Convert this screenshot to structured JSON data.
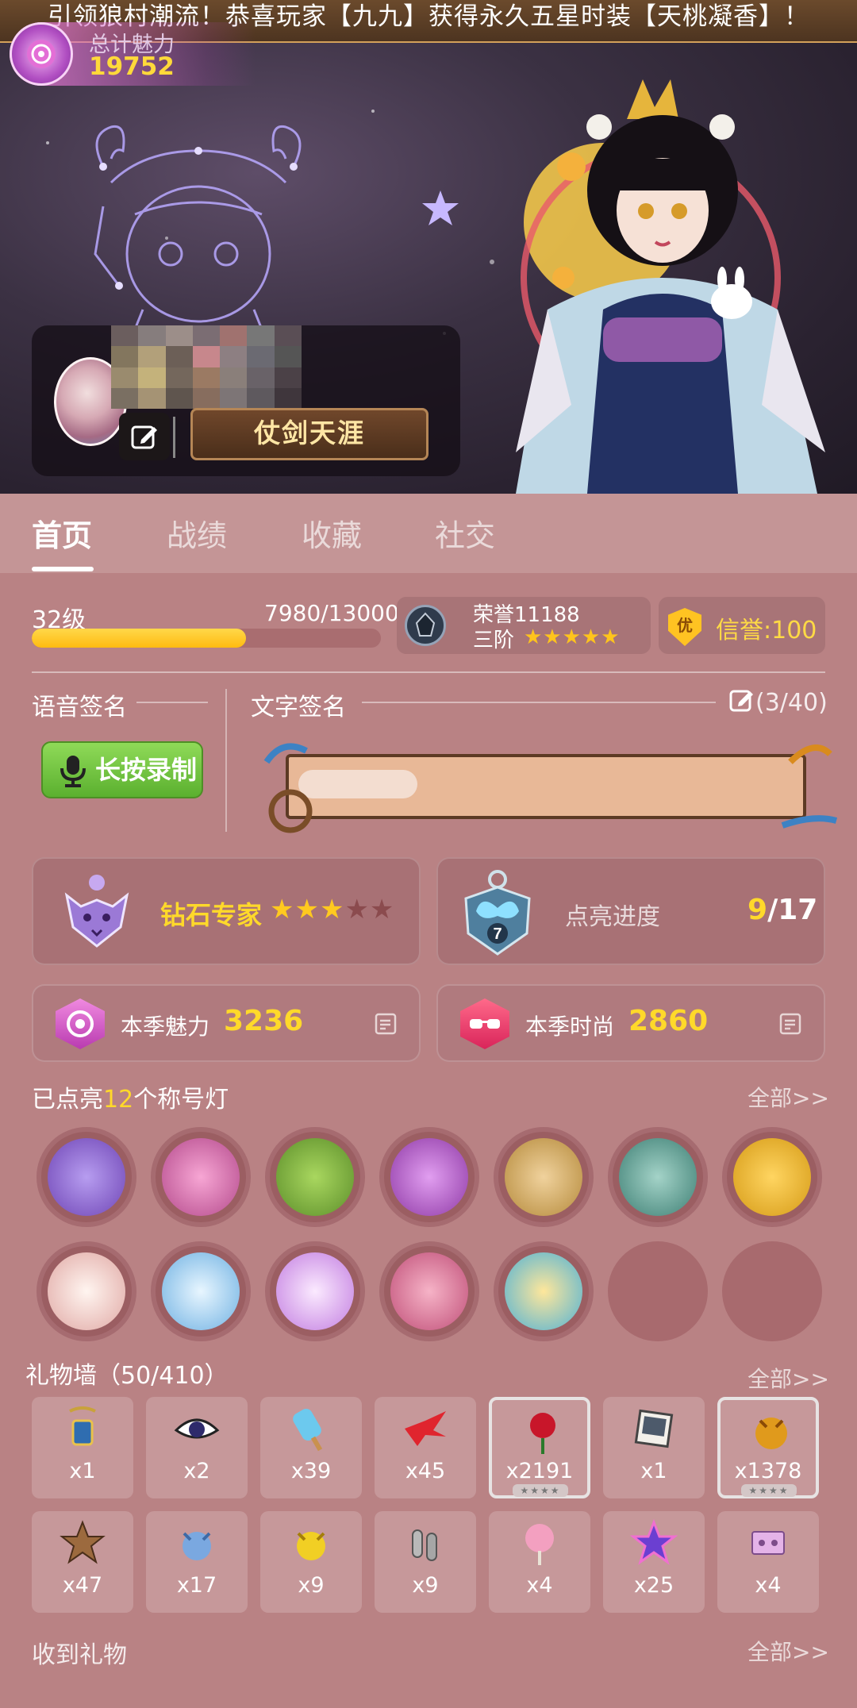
{
  "notice": "引领狼村潮流！恭喜玩家【九九】获得永久五星时装【天桃凝香】！",
  "charm_total": {
    "label": "总计魅力",
    "value": "19752"
  },
  "profile": {
    "title_badge": "仗剑天涯"
  },
  "tabs": [
    {
      "label": "首页",
      "active": true
    },
    {
      "label": "战绩",
      "active": false
    },
    {
      "label": "收藏",
      "active": false
    },
    {
      "label": "社交",
      "active": false
    }
  ],
  "level": {
    "label": "32级",
    "exp": "7980/13000",
    "progress": 0.614
  },
  "honor": {
    "label": "荣誉11188",
    "tier": "三阶",
    "stars": 5
  },
  "credit": {
    "icon_text": "优",
    "label": "信誉:100"
  },
  "signature": {
    "voice_label": "语音签名",
    "text_label": "文字签名",
    "count": "(3/40)",
    "record_button": "长按录制"
  },
  "rank": {
    "name": "钻石专家",
    "stars_on": 3,
    "stars_total": 5,
    "colors": {
      "on": "#ffc91f",
      "off": "#8b4b4e"
    }
  },
  "light": {
    "label": "点亮进度",
    "current": "9",
    "total": "/17",
    "emblem_number": "7"
  },
  "season": [
    {
      "label": "本季魅力",
      "value": "3236",
      "icon": "rose-icon"
    },
    {
      "label": "本季时尚",
      "value": "2860",
      "icon": "sunglasses-icon"
    }
  ],
  "lamps": {
    "prefix": "已点亮",
    "count": "12",
    "suffix": "个称号灯",
    "see_all": "全部>>",
    "items": [
      {
        "name": "cards-lamp"
      },
      {
        "name": "potion-lamp"
      },
      {
        "name": "cannon-lamp"
      },
      {
        "name": "magic-shield-lamp"
      },
      {
        "name": "sword-shield-lamp"
      },
      {
        "name": "crossbow-lamp"
      },
      {
        "name": "dagger-lamp"
      },
      {
        "name": "rose-lamp"
      },
      {
        "name": "pearl-lamp"
      },
      {
        "name": "planet-lamp"
      },
      {
        "name": "lipstick-lamp"
      },
      {
        "name": "popcorn-lamp"
      },
      {
        "name": "empty-slot"
      },
      {
        "name": "empty-slot"
      }
    ]
  },
  "gifts": {
    "title": "礼物墙（50/410）",
    "see_all": "全部>>",
    "items": [
      {
        "name": "amulet-icon",
        "count": "x1"
      },
      {
        "name": "eye-icon",
        "count": "x2"
      },
      {
        "name": "popsicle-icon",
        "count": "x39"
      },
      {
        "name": "paper-crane-icon",
        "count": "x45"
      },
      {
        "name": "rose-icon",
        "count": "x2191",
        "stars": "★★★★"
      },
      {
        "name": "photo-icon",
        "count": "x1"
      },
      {
        "name": "wolf-figure-icon",
        "count": "x1378",
        "stars": "★★★★"
      },
      {
        "name": "sheriff-star-icon",
        "count": "x47"
      },
      {
        "name": "blue-cat-icon",
        "count": "x17"
      },
      {
        "name": "gold-cat-icon",
        "count": "x9"
      },
      {
        "name": "bullet-icon",
        "count": "x9"
      },
      {
        "name": "cotton-candy-icon",
        "count": "x4"
      },
      {
        "name": "star-badge-icon",
        "count": "x25"
      },
      {
        "name": "cassette-icon",
        "count": "x4"
      }
    ]
  },
  "received": {
    "title": "收到礼物",
    "see_all": "全部>>"
  }
}
